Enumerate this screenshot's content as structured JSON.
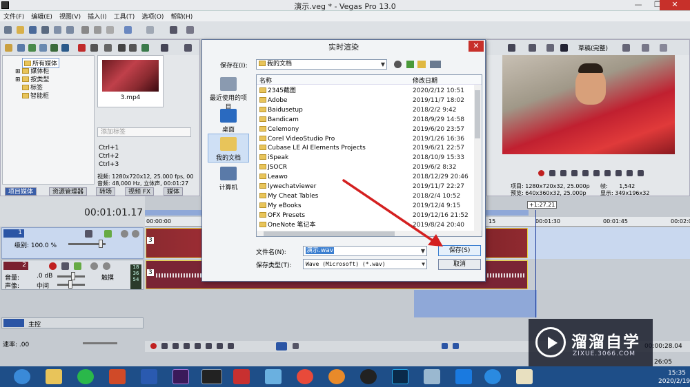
{
  "window": {
    "title": "演示.veg * - Vegas Pro 13.0",
    "minimize": "—",
    "restore": "❐",
    "close": "✕"
  },
  "menu": [
    "文件(F)",
    "编辑(E)",
    "视图(V)",
    "插入(I)",
    "工具(T)",
    "选项(O)",
    "帮助(H)"
  ],
  "explorer": {
    "tree": [
      "所有媒体",
      "媒体柜",
      "按类型",
      "标签",
      "智能柜"
    ],
    "media_file": "3.mp4",
    "tag_placeholder": "添加标签",
    "shortcuts": [
      "Ctrl+1",
      "Ctrl+2",
      "Ctrl+3"
    ],
    "info_video": "视频: 1280x720x12, 25.000 fps, 00",
    "info_audio": "音频: 48,000 Hz, 立体声, 00:01:27",
    "tabs": [
      "项目媒体",
      "资源管理器",
      "转场",
      "视频 FX",
      "媒体"
    ]
  },
  "preview": {
    "quality": "草稿(完整)",
    "project_info": "项目: 1280x720x32, 25.000p",
    "preview_info": "预览: 640x360x32, 25.000p",
    "frame_label": "帧:",
    "frame_value": "1,542",
    "display_label": "显示:",
    "display_value": "349x196x32"
  },
  "timeline": {
    "timecode": "00:01:01.17",
    "ruler_start": "00:00:00",
    "ruler_marks": [
      "15",
      "00:01:30",
      "00:01:45",
      "00:02:00"
    ],
    "playhead_label": "+1:27.21",
    "video_track": {
      "num": "1",
      "level": "级别: 100.0 %"
    },
    "audio_track": {
      "num": "2",
      "vol_label": "音量:",
      "vol_value": ".0 dB",
      "pan_label": "声像:",
      "pan_value": "中间",
      "touch": "触摸",
      "meter": [
        "18",
        "36",
        "54"
      ]
    },
    "master": "主控",
    "rate": "速率: .00",
    "end_time": "00:00:28.04",
    "bottom_time": "26:05",
    "clip_label": "3"
  },
  "dialog": {
    "title": "实时渲染",
    "close": "✕",
    "save_in_label": "保存在(I):",
    "save_in_value": "我的文档",
    "places": [
      "最近使用的项目",
      "桌面",
      "我的文档",
      "计算机"
    ],
    "col_name": "名称",
    "col_date": "修改日期",
    "files": [
      {
        "name": "2345截图",
        "date": "2020/2/12 10:51"
      },
      {
        "name": "Adobe",
        "date": "2019/11/7 18:02"
      },
      {
        "name": "Baidusetup",
        "date": "2018/2/2 9:42"
      },
      {
        "name": "Bandicam",
        "date": "2018/9/29 14:58"
      },
      {
        "name": "Celemony",
        "date": "2019/6/20 23:57"
      },
      {
        "name": "Corel VideoStudio Pro",
        "date": "2019/1/26 16:36"
      },
      {
        "name": "Cubase LE AI Elements Projects",
        "date": "2019/6/21 22:57"
      },
      {
        "name": "iSpeak",
        "date": "2018/10/9 15:33"
      },
      {
        "name": "JSOCR",
        "date": "2019/6/2 8:32"
      },
      {
        "name": "Leawo",
        "date": "2018/12/29 20:46"
      },
      {
        "name": "lywechatviewer",
        "date": "2019/11/7 22:27"
      },
      {
        "name": "My Cheat Tables",
        "date": "2018/2/4 10:52"
      },
      {
        "name": "My eBooks",
        "date": "2019/12/4 9:15"
      },
      {
        "name": "OFX Presets",
        "date": "2019/12/16 21:52"
      },
      {
        "name": "OneNote 笔记本",
        "date": "2019/8/24 20:40"
      }
    ],
    "filename_label": "文件名(N):",
    "filename_value": "演示.wav",
    "filetype_label": "保存类型(T):",
    "filetype_value": "Wave (Microsoft) (*.wav)",
    "save_button": "保存(S)",
    "cancel_button": "取消"
  },
  "taskbar": {
    "time": "15:35",
    "date": "2020/2/19"
  },
  "watermark": {
    "title": "溜溜自学",
    "url": "ZIXUE.3066.COM"
  },
  "colors": {
    "accent": "#3c7fd0",
    "arrow": "#d42020",
    "track_selected": "#c9d8ef",
    "audio_clip": "#8a2b3a",
    "taskbar": "#1e4e88"
  }
}
